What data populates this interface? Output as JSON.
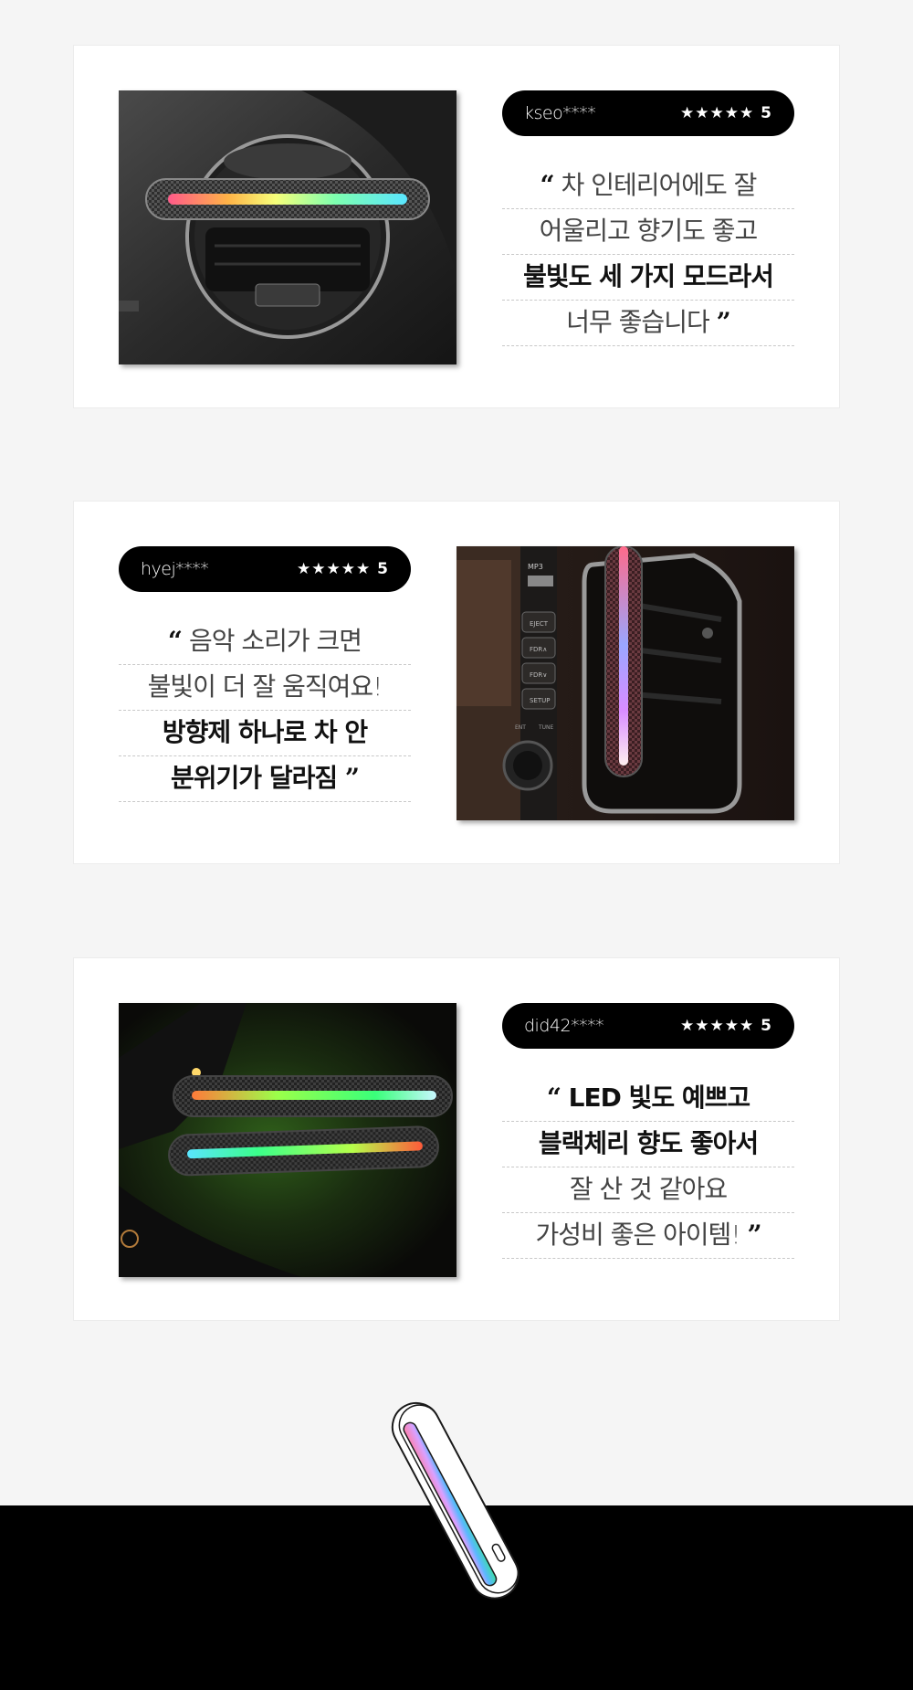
{
  "reviews": [
    {
      "user": "kseo****",
      "rating": "★★★★★ 5",
      "lines": [
        "차 인테리어에도 잘",
        "어울리고 향기도 좋고",
        "불빛도 세 가지 모드라서",
        "너무 좋습니다"
      ],
      "photo_alt": "Rainbow LED air freshener mounted on a round car air vent"
    },
    {
      "user": "hyej****",
      "rating": "★★★★★ 5",
      "lines": [
        "음악 소리가 크면",
        "불빛이 더 잘 움직여요!",
        "방향제 하나로 차 안",
        "분위기가 달라짐"
      ],
      "photo_alt": "Vertical LED freshener glowing next to a car stereo panel"
    },
    {
      "user": "did42****",
      "rating": "★★★★★ 5",
      "lines": [
        "LED 빛도 예쁘고",
        "블랙체리 향도 좋아서",
        "잘 산 것 같아요",
        "가성비 좋은 아이템!"
      ],
      "photo_alt": "Two green LED fresheners glowing in a dark car interior"
    }
  ],
  "stereo": {
    "brand": "MP3",
    "buttons": [
      "EJECT",
      "FDR∧",
      "FDR∨",
      "SETUP"
    ],
    "small": [
      "ENT",
      "TUNE"
    ]
  },
  "quotes": {
    "open": "“",
    "close": "”"
  },
  "colors": {
    "pill": "#000000",
    "card": "#ffffff",
    "page": "#f5f5f5",
    "footer": "#000000"
  }
}
